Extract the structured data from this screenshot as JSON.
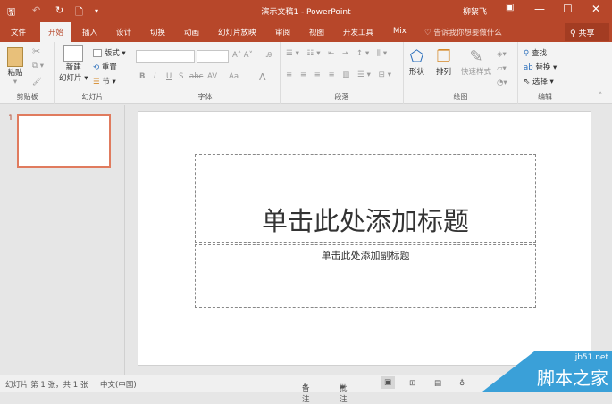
{
  "titlebar": {
    "title": "演示文稿1 - PowerPoint",
    "user": "柳絮飞",
    "accent": "#B7472A"
  },
  "tabs": [
    {
      "label": "文件"
    },
    {
      "label": "开始"
    },
    {
      "label": "插入"
    },
    {
      "label": "设计"
    },
    {
      "label": "切换"
    },
    {
      "label": "动画"
    },
    {
      "label": "幻灯片放映"
    },
    {
      "label": "审阅"
    },
    {
      "label": "视图"
    },
    {
      "label": "开发工具"
    },
    {
      "label": "Mix"
    }
  ],
  "tell_me": "告诉我你想要做什么",
  "share": "共享",
  "ribbon": {
    "clipboard": {
      "paste": "粘贴",
      "label": "剪贴板"
    },
    "slides": {
      "new_slide_1": "新建",
      "new_slide_2": "幻灯片",
      "layout": "版式",
      "reset": "重置",
      "section": "节",
      "label": "幻灯片"
    },
    "font": {
      "label": "字体",
      "bold": "B",
      "italic": "I",
      "underline": "U",
      "shadow": "S",
      "strike": "abc",
      "spacing": "AV",
      "case": "Aa",
      "color": "A"
    },
    "paragraph": {
      "label": "段落"
    },
    "drawing": {
      "shapes": "形状",
      "arrange": "排列",
      "quick_styles": "快速样式",
      "label": "绘图"
    },
    "editing": {
      "find": "查找",
      "replace": "替换",
      "select": "选择",
      "label": "编辑"
    }
  },
  "thumbnails": [
    {
      "number": "1"
    }
  ],
  "slide": {
    "title_placeholder": "单击此处添加标题",
    "subtitle_placeholder": "单击此处添加副标题"
  },
  "status": {
    "slide_info": "幻灯片 第 1 张，共 1 张",
    "language": "中文(中国)",
    "notes": "备注",
    "comments": "批注"
  },
  "watermark": {
    "site": "jb51.net",
    "name": "脚本之家"
  }
}
